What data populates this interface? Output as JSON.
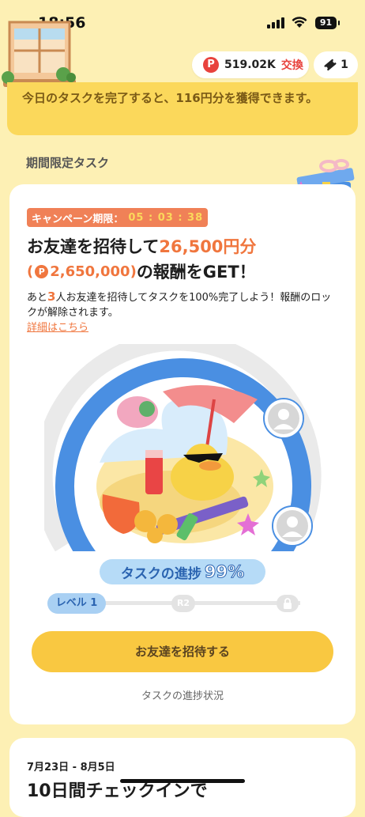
{
  "status": {
    "time": "18:56",
    "battery": "91"
  },
  "header": {
    "points": "519.02K",
    "points_badge": "P",
    "exchange_label": "交換",
    "tickets": "1"
  },
  "banner": {
    "text_before": "今日のタスクを完了すると、",
    "amount": "116",
    "text_after": "円分を獲得できます。"
  },
  "section": {
    "label": "期間限定タスク"
  },
  "campaign": {
    "timer_label": "キャンペーン期限：",
    "timer_value": "05 : 03 : 38",
    "headline_pre": "お友達を招待して",
    "headline_amount": "26,500円分",
    "points_open": "(",
    "points_badge": "P",
    "points_amount": "2,650,000)",
    "headline_post": "の報酬をGET！",
    "desc_pre": "あと",
    "desc_num": "3",
    "desc_post": "人お友達を招待してタスクを100%完了しよう！報酬のロックが解除されます。",
    "detail_link": "詳細はこちら",
    "progress": 0.99,
    "progress_label": "タスクの進捗",
    "progress_value": "99%",
    "level1": "レベル 1",
    "level2": "R2",
    "cta": "お友達を招待する",
    "status_link": "タスクの進捗状況"
  },
  "next_task": {
    "date_range": "7月23日 - 8月5日",
    "title": "10日間チェックインで"
  },
  "colors": {
    "accent_orange": "#f0763e",
    "ring_blue": "#4a8fe2",
    "cta_yellow": "#f9c841",
    "points_red": "#e8423d"
  }
}
